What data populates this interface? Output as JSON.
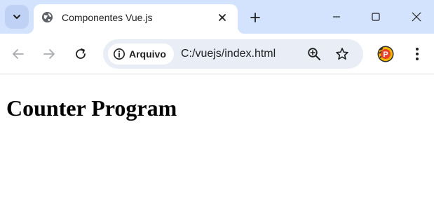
{
  "browser": {
    "tab": {
      "title": "Componentes Vue.js",
      "favicon": "globe-icon"
    },
    "address_bar": {
      "security_chip_label": "Arquivo",
      "url": "C:/vuejs/index.html"
    },
    "icons": {
      "tab_search": "chevron-down-icon",
      "close_tab": "close-icon",
      "new_tab": "plus-icon",
      "minimize": "minimize-icon",
      "maximize": "maximize-icon",
      "close_window": "close-window-icon",
      "back": "back-arrow-icon",
      "forward": "forward-arrow-icon",
      "reload": "reload-icon",
      "site_info": "info-icon",
      "zoom": "zoom-in-icon",
      "bookmark": "star-icon",
      "extension": "profile-avatar-icon",
      "menu": "kebab-menu-icon"
    },
    "colors": {
      "tabstrip": "#d3e3fd",
      "omnibox": "#e9eef6",
      "extension_badge": "#e8412c"
    }
  },
  "page": {
    "heading": "Counter Program"
  }
}
